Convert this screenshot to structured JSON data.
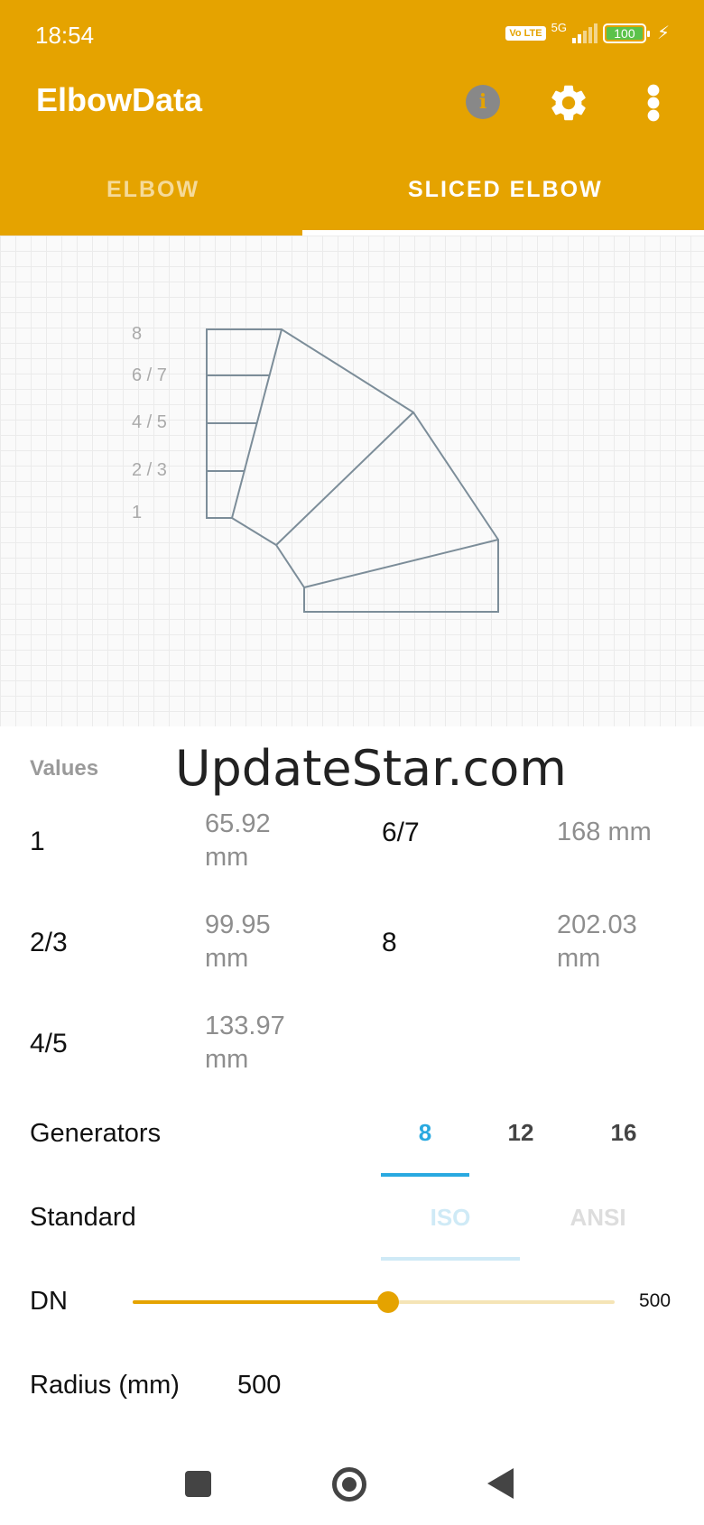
{
  "status_bar": {
    "time": "18:54",
    "network": "5G",
    "volte": "Vo LTE",
    "battery": "100",
    "battery_level": 1.0
  },
  "app_bar": {
    "title": "ElbowData",
    "info_icon": "info-icon",
    "settings_icon": "gear-icon",
    "more_icon": "more-vertical-icon"
  },
  "tabs": [
    {
      "label": "ELBOW",
      "selected": false
    },
    {
      "label": "SLICED ELBOW",
      "selected": true
    }
  ],
  "drawing": {
    "labels": [
      "8",
      "6 / 7",
      "4 / 5",
      "2 / 3",
      "1"
    ]
  },
  "watermark": "UpdateStar.com",
  "values": {
    "title": "Values",
    "items": [
      {
        "key": "1",
        "value": "65.92 mm"
      },
      {
        "key": "2/3",
        "value": "99.95 mm"
      },
      {
        "key": "4/5",
        "value": "133.97 mm"
      },
      {
        "key": "6/7",
        "value": "168 mm"
      },
      {
        "key": "8",
        "value": "202.03 mm"
      }
    ]
  },
  "generators": {
    "label": "Generators",
    "options": [
      "8",
      "12",
      "16"
    ],
    "selected": "8"
  },
  "standard": {
    "label": "Standard",
    "options": [
      "ISO",
      "ANSI"
    ],
    "selected": "ISO",
    "enabled": false
  },
  "dn": {
    "label": "DN",
    "value": "500",
    "slider_fraction": 0.53
  },
  "radius": {
    "label": "Radius (mm)",
    "value": "500"
  },
  "colors": {
    "accent": "#E5A300",
    "segment_selected": "#29A9E0",
    "segment_disabled": "#CFEAF6"
  },
  "nav": {
    "recent": "square-icon",
    "home": "home-circle-icon",
    "back": "back-triangle-icon"
  }
}
